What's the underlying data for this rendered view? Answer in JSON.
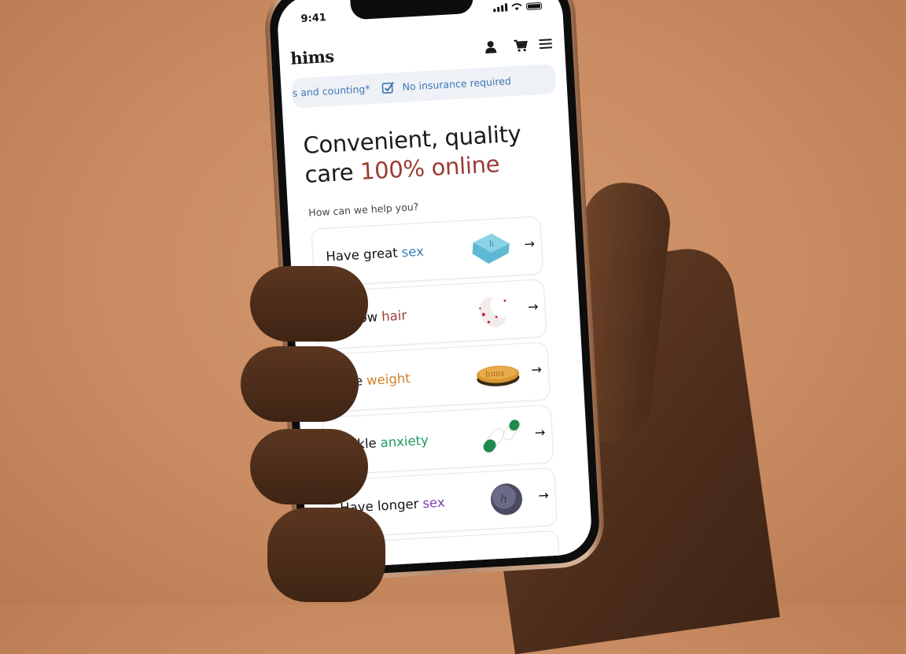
{
  "status_bar": {
    "time": "9:41"
  },
  "header": {
    "logo": "hims",
    "icons": [
      "user-icon",
      "cart-icon",
      "menu-icon"
    ]
  },
  "ticker": {
    "item_1": "s and counting*",
    "item_2": "No insurance required"
  },
  "hero": {
    "title_line_1": "Convenient, quality",
    "title_line_2_prefix": "care",
    "title_line_2_accent": "100% online"
  },
  "helper_text": "How can we help you?",
  "cards": [
    {
      "prefix": "Have great",
      "accent": "sex",
      "accent_color": "#3a7db5"
    },
    {
      "prefix": "Regrow",
      "accent": "hair",
      "accent_color": "#9c3b36"
    },
    {
      "prefix": "Lose",
      "accent": "weight",
      "accent_color": "#d0822a"
    },
    {
      "prefix": "Tackle",
      "accent": "anxiety",
      "accent_color": "#1f9a5c"
    },
    {
      "prefix": "Have longer",
      "accent": "sex",
      "accent_color": "#7a3fb0"
    }
  ],
  "pill_logo_text": "hims",
  "colors": {
    "background": "#c98b61",
    "hero_accent": "#9c3b36",
    "ticker_text": "#3f76b5"
  }
}
